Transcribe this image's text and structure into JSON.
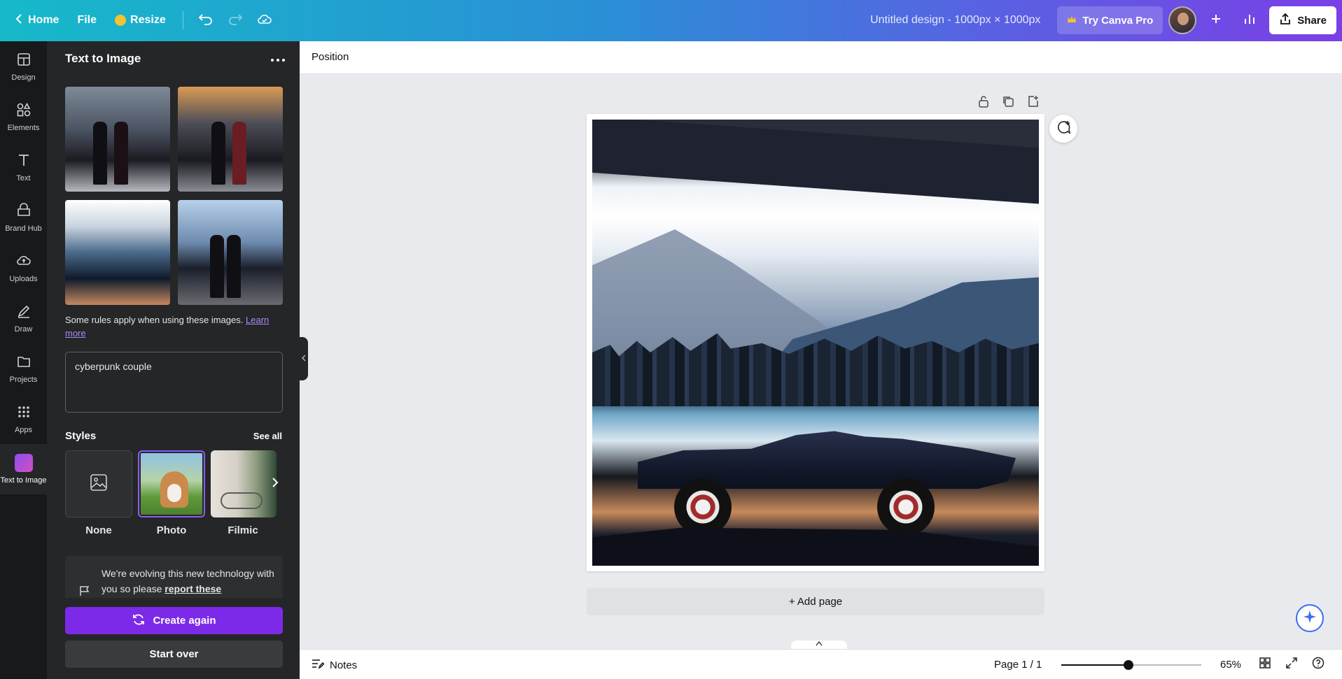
{
  "topbar": {
    "home_label": "Home",
    "file_label": "File",
    "resize_label": "Resize",
    "doc_title": "Untitled design - 1000px × 1000px",
    "pro_label": "Try Canva Pro",
    "share_label": "Share"
  },
  "rail": {
    "items": [
      {
        "label": "Design",
        "icon": "design-icon"
      },
      {
        "label": "Elements",
        "icon": "elements-icon"
      },
      {
        "label": "Text",
        "icon": "text-icon"
      },
      {
        "label": "Brand Hub",
        "icon": "brand-hub-icon"
      },
      {
        "label": "Uploads",
        "icon": "uploads-icon"
      },
      {
        "label": "Draw",
        "icon": "draw-icon"
      },
      {
        "label": "Projects",
        "icon": "projects-icon"
      },
      {
        "label": "Apps",
        "icon": "apps-icon"
      },
      {
        "label": "Text to Image",
        "icon": "text-to-image-icon"
      }
    ]
  },
  "panel": {
    "title": "Text to Image",
    "rules_text": "Some rules apply when using these images.",
    "learn_more": "Learn more",
    "prompt": "cyberpunk couple",
    "styles_label": "Styles",
    "see_all": "See all",
    "styles": [
      {
        "name": "None"
      },
      {
        "name": "Photo",
        "selected": true
      },
      {
        "name": "Filmic"
      }
    ],
    "notice_text": "We're evolving this new technology with you so please",
    "notice_link": "report these",
    "create_again": "Create again",
    "start_over": "Start over"
  },
  "toolbar": {
    "position_label": "Position"
  },
  "canvas": {
    "add_page": "+ Add page"
  },
  "bottombar": {
    "notes_label": "Notes",
    "page_info": "Page 1 / 1",
    "zoom_label": "65%",
    "zoom_fraction": 0.48
  },
  "colors": {
    "accent": "#7d2ae8",
    "panel_bg": "#252627",
    "rail_bg": "#18191b"
  }
}
